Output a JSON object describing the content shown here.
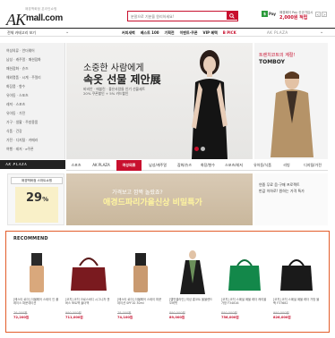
{
  "header": {
    "logo_sub": "애경백화점 온라인쇼핑",
    "logo_main": "AK",
    "logo_domain": "mall.com",
    "search_placeholder": "분말으로 기분을 원리하세요!",
    "pay_icon": "$",
    "pay_label": "Pay",
    "pay_sub": "애경페이 Pay 신규가입시",
    "pay_amount": "2,000원 적립",
    "nav_prev": "<",
    "nav_next": ">"
  },
  "navbar": {
    "category_label": "전체 카테고리 보기",
    "links": [
      "커피새벽",
      "베스트 100",
      "기획전",
      "이벤트·쿠폰",
      "VIP 혜택",
      "B PICK"
    ],
    "right_label": "AK PLAZA"
  },
  "sidebar": {
    "items": [
      "여성의류 · 언더웨어",
      "남성 · 캐주얼 · 패션잡화",
      "패션잡화 · 슈즈",
      "해외명품 · 시계 · 주얼리",
      "화장품 · 향수",
      "유아동 · 스포츠",
      "레져 · 스포츠",
      "유아동 · 가전",
      "가구 · 생활 · 주방용품",
      "식품 · 건강",
      "가전 · 디지털 · 카메라",
      "여행 · 레저 · e쿠폰"
    ],
    "footer_logo": "AK PLAZA"
  },
  "hero": {
    "title1": "소중한 사람에게",
    "title2": "속옷 선물 제안展",
    "desc1": "비비안 · 에블린 · 좋은사람들 인기 선물세트",
    "desc2": "20% 쿠폰할인 + 5% 카드할인"
  },
  "right_banner": {
    "title1": "트렌치코트의 계절!",
    "title2": "TOMBOY"
  },
  "category_tabs": [
    "스포츠",
    "AK PLAZA",
    "여성의류",
    "남성/캐주얼",
    "잡화/슈즈",
    "화장/향수",
    "스포츠/레저",
    "유아동/식품",
    "리빙",
    "디지털/가전"
  ],
  "second_row": {
    "left_title": "애경백화점 스마트쇼핑",
    "left_pct": "29",
    "left_pct_unit": "%",
    "hero_t1": "가격보고 깜짝 놀랐죠?",
    "hero_t2": "애경드파리가을신상 비밀특가",
    "right_t1": "연중 무료 음·구매 프로젝트",
    "right_t2": "반값 이하로! 원하는 가격 특가"
  },
  "recommend": {
    "title": "RECOMMEND",
    "products": [
      {
        "name": "[에스티 로더] 더블웨어 스테이 인 플레이스 파운데이션",
        "orig": "76,000원",
        "price": "72,200원",
        "type": "foundation"
      },
      {
        "name": "[코치] 코치 크로스바디 시그니처 캔버스 토트백 숄더백",
        "orig": "990,000원",
        "price": "711,000원",
        "type": "bag-red"
      },
      {
        "name": "[에스티 로더] 더블웨어 스테이 파운데이션 SPF10 30ml",
        "orig": "78,000원",
        "price": "74,100원",
        "type": "foundation2"
      },
      {
        "name": "[캘빈클라인] 여성 롱코트 울블렌드 오버핏",
        "orig": "890,000원",
        "price": "89,000원",
        "type": "coat"
      },
      {
        "name": "[코치] 코치 스페셜 페블 레더 캐리올 가방 F34816",
        "orig": "890,000원",
        "price": "756,000원",
        "type": "bag-green"
      },
      {
        "name": "[코치] 코치 스페셜 페블 레더 가방 블랙 F37682",
        "orig": "990,000원",
        "price": "826,000원",
        "type": "bag-black"
      }
    ]
  },
  "colors": {
    "brand_red": "#c8102e",
    "recommend_border": "#e35d2a",
    "pay_green": "#2b9a3a"
  }
}
